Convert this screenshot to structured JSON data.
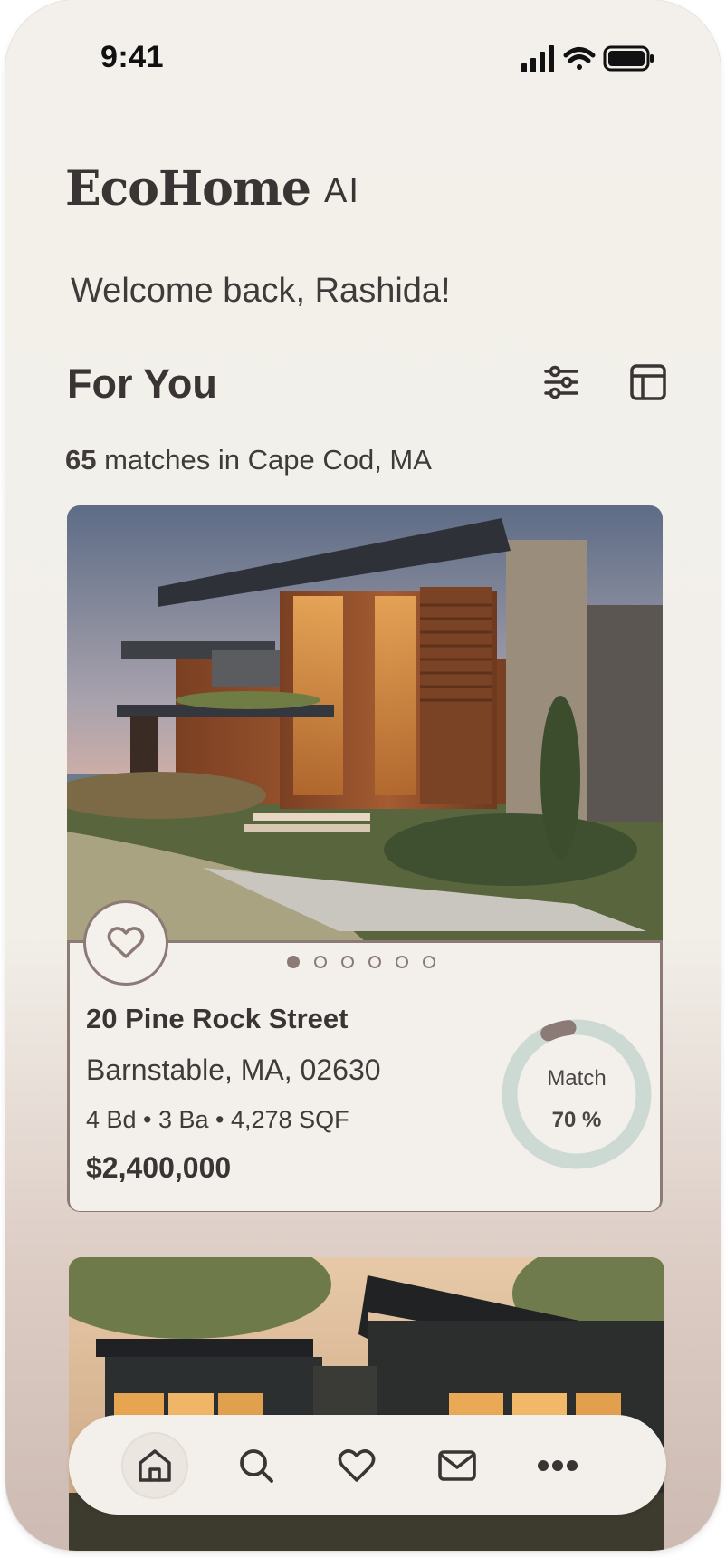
{
  "status_bar": {
    "time": "9:41"
  },
  "app": {
    "brand": "EcoHome",
    "brand_suffix": "AI"
  },
  "greeting": "Welcome back, Rashida!",
  "section": {
    "title": "For You",
    "match_count": "65",
    "match_text": " matches in Cape Cod, MA"
  },
  "listing": {
    "street": "20 Pine Rock Street",
    "city": "Barnstable, MA, 02630",
    "specs": "4 Bd • 3 Ba • 4,278 SQF",
    "price": "$2,400,000",
    "match_label": "Match",
    "match_value": "70 %",
    "match_percent": 70,
    "photo_count": 6,
    "active_photo": 1
  },
  "nav": {
    "items": [
      "home-icon",
      "search-icon",
      "heart-icon",
      "mail-icon",
      "more-icon"
    ],
    "active": "home-icon"
  },
  "colors": {
    "accent": "#8b7a76",
    "ring_track": "#cdd9d3",
    "background": "#f3f0eb"
  }
}
